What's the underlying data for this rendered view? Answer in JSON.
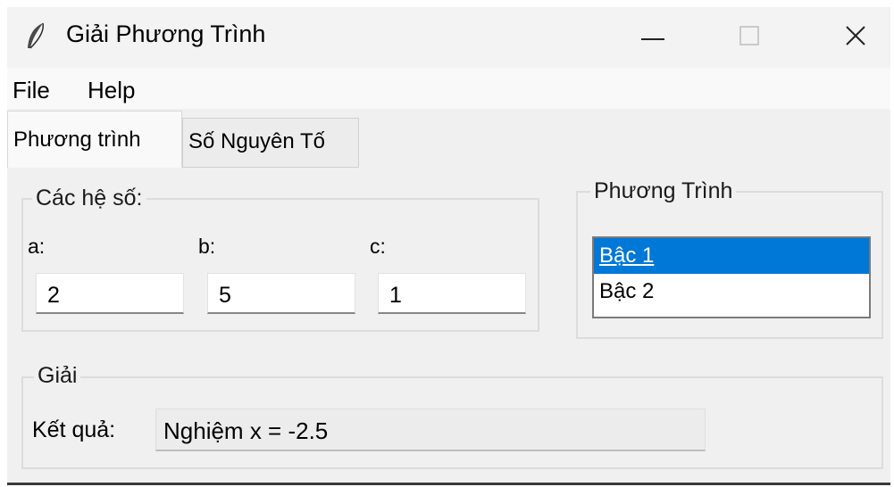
{
  "window": {
    "title": "Giải Phương Trình",
    "controls": {
      "minimize": "—",
      "close": "✕"
    }
  },
  "menu": {
    "items": [
      "File",
      "Help"
    ]
  },
  "tabs": [
    {
      "label": "Phương trình",
      "active": true
    },
    {
      "label": "Số Nguyên Tố",
      "active": false
    }
  ],
  "coefficients": {
    "group_title": "Các hệ số:",
    "a_label": "a:",
    "a_value": "2",
    "b_label": "b:",
    "b_value": "5",
    "c_label": "c:",
    "c_value": "1"
  },
  "equation": {
    "group_title": "Phương Trình",
    "options": [
      "Bậc 1",
      "Bậc 2"
    ],
    "selected": "Bậc 1"
  },
  "solve": {
    "group_title": "Giải",
    "result_label": "Kết quả:",
    "result_value": "Nghiệm x = -2.5"
  },
  "colors": {
    "selection": "#0078d7",
    "window_bg": "#f0f0f0"
  },
  "icons": {
    "app": "feather-icon",
    "minimize": "minimize-icon",
    "maximize": "maximize-icon",
    "close": "close-icon"
  }
}
